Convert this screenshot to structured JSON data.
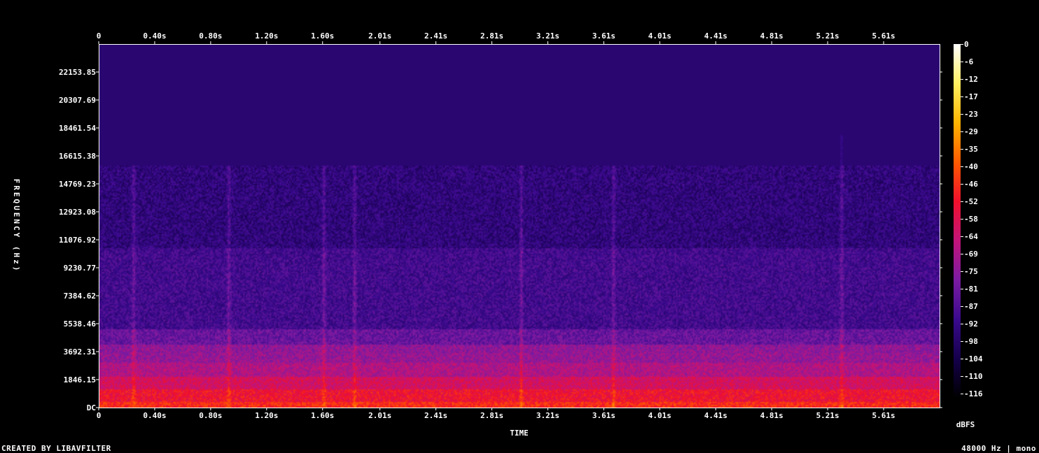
{
  "chart_data": {
    "type": "heatmap",
    "xlabel": "TIME",
    "ylabel": "FREQUENCY (Hz)",
    "x_ticks": [
      "0",
      "0.40s",
      "0.80s",
      "1.20s",
      "1.60s",
      "2.01s",
      "2.41s",
      "2.81s",
      "3.21s",
      "3.61s",
      "4.01s",
      "4.41s",
      "4.81s",
      "5.21s",
      "5.61s"
    ],
    "x_tick_values": [
      0,
      0.4,
      0.8,
      1.2,
      1.6,
      2.01,
      2.41,
      2.81,
      3.21,
      3.61,
      4.01,
      4.41,
      4.81,
      5.21,
      5.61
    ],
    "xlim": [
      0,
      6.01
    ],
    "y_ticks": [
      "DC",
      "1846.15",
      "3692.31",
      "5538.46",
      "7384.62",
      "9230.77",
      "11076.92",
      "12923.08",
      "14769.23",
      "16615.38",
      "18461.54",
      "20307.69",
      "22153.85"
    ],
    "y_tick_values": [
      0,
      1846.15,
      3692.31,
      5538.46,
      7384.62,
      9230.77,
      11076.92,
      12923.08,
      14769.23,
      16615.38,
      18461.54,
      20307.69,
      22153.85
    ],
    "ylim": [
      0,
      24000
    ],
    "colorbar": {
      "label": "dBFS",
      "ticks": [
        "0",
        "-6",
        "-12",
        "-17",
        "-23",
        "-29",
        "-35",
        "-40",
        "-46",
        "-52",
        "-58",
        "-64",
        "-69",
        "-75",
        "-81",
        "-87",
        "-92",
        "-98",
        "-104",
        "-110",
        "-116"
      ],
      "range": [
        -120,
        0
      ],
      "colors": [
        "#000000",
        "#14004a",
        "#3a0a8e",
        "#7a1ba2",
        "#c2147a",
        "#f0102c",
        "#ff5a00",
        "#ffb400",
        "#ffef60",
        "#ffffff"
      ]
    },
    "content_cutoff_hz": 16000,
    "spectrum": {
      "band_edges_hz": [
        0,
        400,
        1200,
        2000,
        3000,
        3600,
        4200,
        5200,
        10500,
        16000,
        24000
      ],
      "band_levels_db": [
        -48,
        -54,
        -62,
        -70,
        -75,
        -76,
        -84,
        -92,
        -97,
        -99,
        -125
      ]
    },
    "transients_s": [
      0.25,
      0.93,
      1.61,
      1.83,
      3.02,
      3.68,
      5.31
    ]
  },
  "footer": {
    "credit": "CREATED BY LIBAVFILTER",
    "info": "48000 Hz | mono"
  }
}
